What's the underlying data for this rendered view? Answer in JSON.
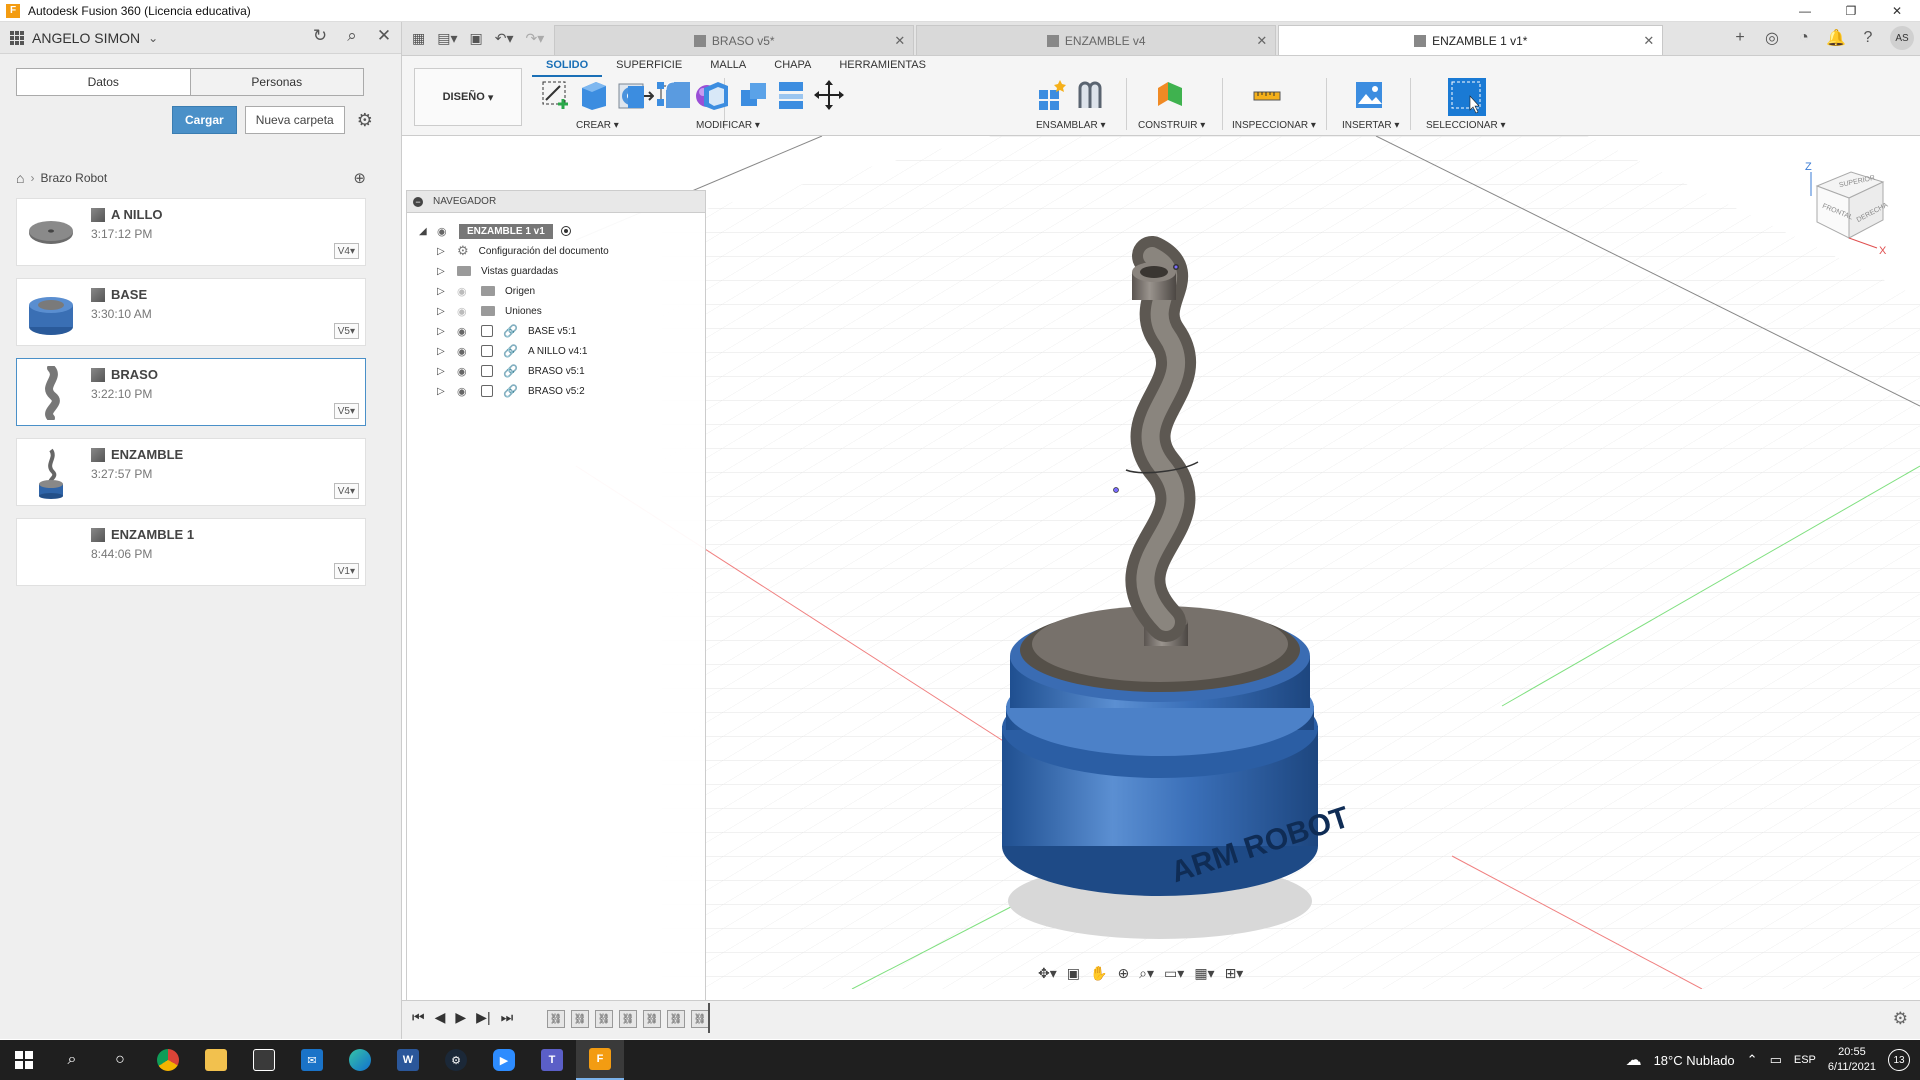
{
  "window": {
    "title": "Autodesk Fusion 360 (Licencia educativa)",
    "app_logo": "F"
  },
  "datapanel": {
    "user": "ANGELO SIMON",
    "tabs": [
      "Datos",
      "Personas"
    ],
    "upload_label": "Cargar",
    "new_folder_label": "Nueva carpeta",
    "breadcrumb": "Brazo Robot",
    "items": [
      {
        "name": "A NILLO",
        "time": "3:17:12 PM",
        "version": "V4"
      },
      {
        "name": "BASE",
        "time": "3:30:10 AM",
        "version": "V5"
      },
      {
        "name": "BRASO",
        "time": "3:22:10 PM",
        "version": "V5"
      },
      {
        "name": "ENZAMBLE",
        "time": "3:27:57 PM",
        "version": "V4"
      },
      {
        "name": "ENZAMBLE 1",
        "time": "8:44:06 PM",
        "version": "V1"
      }
    ]
  },
  "doc_tabs": [
    {
      "label": "BRASO v5*"
    },
    {
      "label": "ENZAMBLE v4"
    },
    {
      "label": "ENZAMBLE 1 v1*"
    }
  ],
  "avatar_initials": "AS",
  "ribbon": {
    "workspace": "DISEÑO",
    "tabs": [
      "SOLIDO",
      "SUPERFICIE",
      "MALLA",
      "CHAPA",
      "HERRAMIENTAS"
    ],
    "groups": [
      "CREAR",
      "MODIFICAR",
      "ENSAMBLAR",
      "CONSTRUIR",
      "INSPECCIONAR",
      "INSERTAR",
      "SELECCIONAR"
    ]
  },
  "navigator": {
    "title": "NAVEGADOR",
    "root": "ENZAMBLE 1 v1",
    "rows": [
      {
        "label": "Configuración del documento"
      },
      {
        "label": "Vistas guardadas"
      },
      {
        "label": "Origen"
      },
      {
        "label": "Uniones"
      },
      {
        "label": "BASE v5:1"
      },
      {
        "label": "A NILLO v4:1"
      },
      {
        "label": "BRASO v5:1"
      },
      {
        "label": "BRASO v5:2"
      }
    ]
  },
  "viewcube": {
    "top": "SUPERIOR",
    "front": "FRONTAL",
    "right": "DERECHA",
    "axis_z": "Z",
    "axis_x": "X"
  },
  "model_text": "ARM ROBOT",
  "taskbar": {
    "weather": "18°C  Nublado",
    "lang": "ESP",
    "time": "20:55",
    "date": "6/11/2021",
    "notifications": "13"
  }
}
